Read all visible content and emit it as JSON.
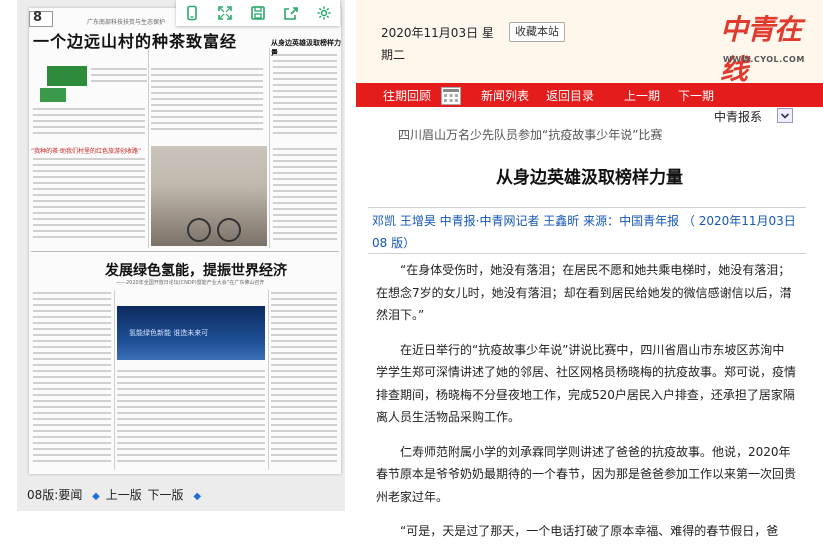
{
  "toolbar": {
    "icons": [
      "phone-icon",
      "fullscreen-icon",
      "save-icon",
      "share-icon",
      "settings-icon"
    ]
  },
  "paper_preview": {
    "page_badge": "8",
    "kicker": "广东南部科技扶贫与生态保护",
    "headline_main": "一个边远山村的种茶致富经",
    "headline_side": "从身边英雄汲取榜样力量",
    "caption_red": "“我种的茶·助我们村里的红色旅游创收路”",
    "headline_lower": "发展绿色氢能，提振世界经济",
    "subhead_lower": "——2020年全国开放日论坛(CNDP)暨能产业大会”在广东佛山召开",
    "screen_text": "氢能绿色新能 谁造未来可",
    "nav": {
      "current": "08版:要闻",
      "prev": "上一版",
      "next": "下一版"
    }
  },
  "header": {
    "date": "2020年11月03日 星",
    "weekday": "期二",
    "favorite_button": "收藏本站",
    "logo_text": "中青在线",
    "logo_url": "WWW.CYOL.COM"
  },
  "nav_bar": {
    "items": [
      "往期回顾",
      "新闻列表",
      "返回目录",
      "上一期",
      "下一期"
    ]
  },
  "paper_select": {
    "value": "中青报系"
  },
  "article": {
    "lead": "四川眉山万名少先队员参加“抗疫故事少年说”比赛",
    "title": "从身边英雄汲取榜样力量",
    "byline": "邓凯  王增昊  中青报·中青网记者  王鑫昕      来源：中国青年报      （  2020年11月03日      08  版）",
    "paragraphs": [
      "“在身体受伤时，她没有落泪；在居民不愿和她共乘电梯时，她没有落泪；在想念7岁的女儿时，她没有落泪；却在看到居民给她发的微信感谢信以后，潸然泪下。”",
      "在近日举行的“抗疫故事少年说”讲说比赛中，四川省眉山市东坡区苏洵中学学生郑可深情讲述了她的邻居、社区网格员杨晓梅的抗疫故事。郑可说，疫情排查期间，杨晓梅不分昼夜地工作，完成520户居民入户排查，还承担了居家隔离人员生活物品采购工作。",
      "仁寿师范附属小学的刘承霖同学则讲述了爸爸的抗疫故事。他说，2020年春节原本是爷爷奶奶最期待的一个春节，因为那是爸爸参加工作以来第一次回贵州老家过年。",
      "“可是，天是过了那天，一个电话打破了原本幸福、难得的春节假日，爸"
    ]
  }
}
